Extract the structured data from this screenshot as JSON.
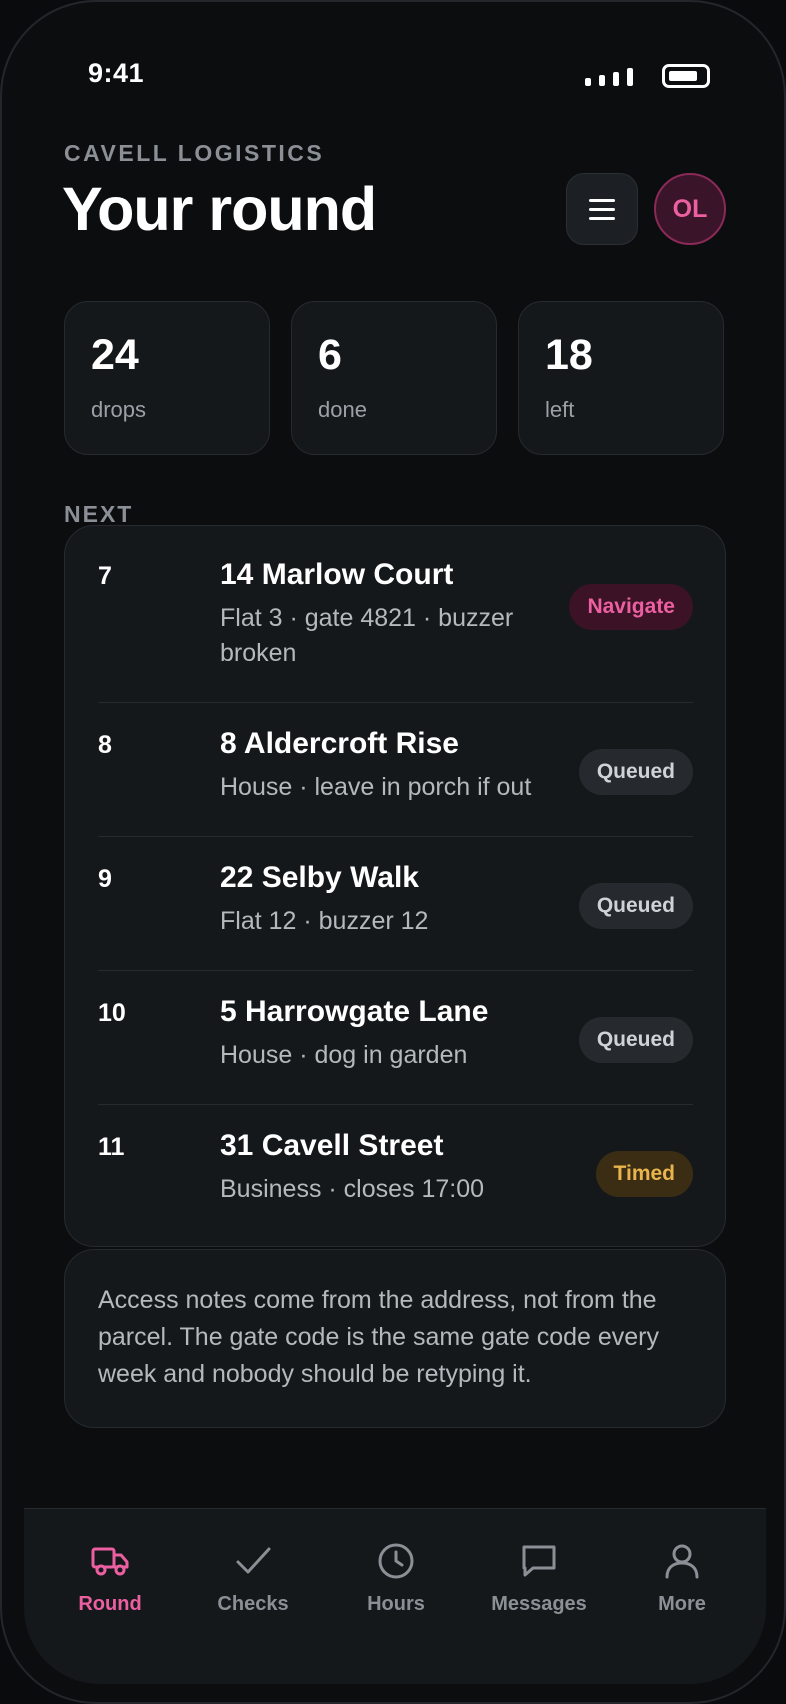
{
  "status_bar": {
    "time": "9:41"
  },
  "header": {
    "brand": "CAVELL LOGISTICS",
    "title": "Your round",
    "avatar_initials": "OL"
  },
  "stats": [
    {
      "value": "24",
      "label": "drops"
    },
    {
      "value": "6",
      "label": "done"
    },
    {
      "value": "18",
      "label": "left"
    }
  ],
  "section_label": "NEXT",
  "stops": [
    {
      "number": "7",
      "address": "14 Marlow Court",
      "note_line1": "Flat 3 · gate 4821 · buzzer",
      "note_line2": "broken",
      "status": "Navigate"
    },
    {
      "number": "8",
      "address": "8 Aldercroft Rise",
      "note_line1": "House · leave in porch if out",
      "status": "Queued"
    },
    {
      "number": "9",
      "address": "22 Selby Walk",
      "note_line1": "Flat 12 · buzzer 12",
      "status": "Queued"
    },
    {
      "number": "10",
      "address": "5 Harrowgate Lane",
      "note_line1": "House · dog in garden",
      "status": "Queued"
    },
    {
      "number": "11",
      "address": "31 Cavell Street",
      "note_line1": "Business · closes 17:00",
      "status": "Timed"
    }
  ],
  "access_note": "Access notes come from the address, not from the parcel. The gate code is the same gate code every week and nobody should be retyping it.",
  "tabs": [
    {
      "label": "Round",
      "icon": "truck-icon",
      "active": true
    },
    {
      "label": "Checks",
      "icon": "check-icon",
      "active": false
    },
    {
      "label": "Hours",
      "icon": "clock-icon",
      "active": false
    },
    {
      "label": "Messages",
      "icon": "message-icon",
      "active": false
    },
    {
      "label": "More",
      "icon": "user-icon",
      "active": false
    }
  ],
  "colors": {
    "accent": "#ec5fa0",
    "background": "#0c0d0f",
    "card": "#15181b",
    "timed": "#e9b44c"
  }
}
